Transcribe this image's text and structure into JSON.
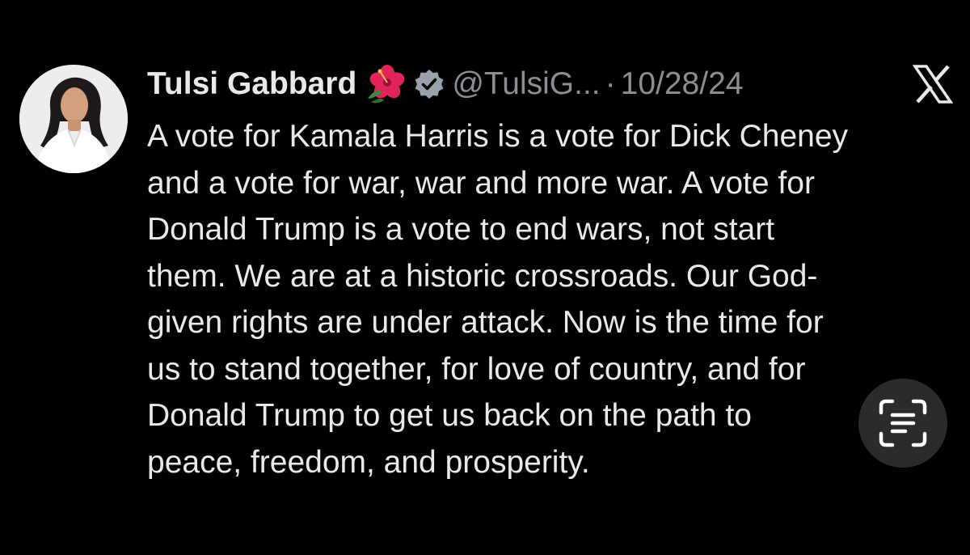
{
  "tweet": {
    "author": {
      "display_name": "Tulsi Gabbard",
      "handle": "@TulsiG...",
      "avatar": "profile-photo",
      "emoji": "hibiscus",
      "verified": true
    },
    "separator": "·",
    "date": "10/28/24",
    "text_lines": [
      "A vote for Kamala Harris is a vote for Dick Cheney",
      "and a vote for war, war and more war.  A vote for",
      "Donald Trump is a vote to end wars, not start",
      "them. We are at a historic crossroads. Our God-",
      "given rights are under attack. Now is the time for",
      "us to stand together, for love of country, and for",
      "Donald Trump to get us back on the path to",
      "peace, freedom, and prosperity."
    ]
  },
  "icons": {
    "platform_logo": "x-logo-icon",
    "verified_badge": "verified-badge-icon",
    "live_text": "live-text-icon"
  },
  "colors": {
    "background": "#000000",
    "text_primary": "#e7e9ea",
    "text_secondary": "#8b8f94",
    "verified_badge": "#9aa3ad",
    "live_text_button": "#2b2b2d"
  }
}
